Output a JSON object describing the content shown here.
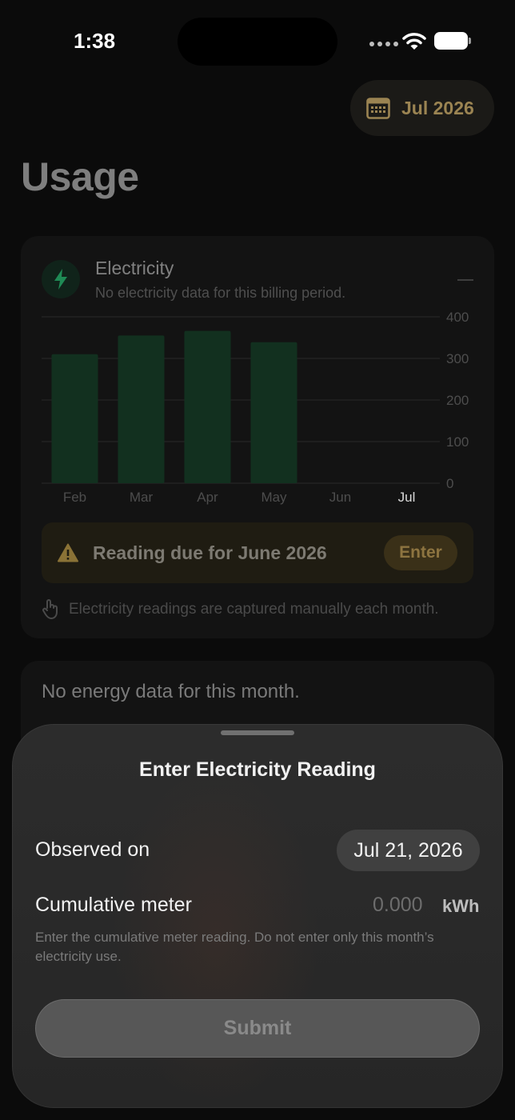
{
  "status_bar": {
    "time": "1:38"
  },
  "header": {
    "month_label": "Jul 2026",
    "month_icon": "calendar-icon",
    "title": "Usage"
  },
  "electricity_card": {
    "title": "Electricity",
    "subtitle": "No electricity data for this billing period.",
    "icon": "bolt-icon",
    "collapse_icon": "minus-icon",
    "due_banner": {
      "icon": "warning-icon",
      "text": "Reading due for June 2026",
      "button": "Enter"
    },
    "hint": {
      "icon": "hand-tap-icon",
      "text": "Electricity readings are captured manually each month."
    }
  },
  "chart_data": {
    "type": "bar",
    "categories": [
      "Feb",
      "Mar",
      "Apr",
      "May",
      "Jun",
      "Jul"
    ],
    "values": [
      310,
      355,
      366,
      339,
      null,
      null
    ],
    "ylim": [
      0,
      400
    ],
    "yticks": [
      0,
      100,
      200,
      300,
      400
    ],
    "highlighted_category": "Jul",
    "grid": true,
    "colors": {
      "bar": "#12301f",
      "grid": "#2a2a2a",
      "tick": "#4d4d4d",
      "highlight": "#d9d9d9"
    }
  },
  "energy_card": {
    "text": "No energy data for this month."
  },
  "sheet": {
    "title": "Enter Electricity Reading",
    "observed_label": "Observed on",
    "observed_date": "Jul 21, 2026",
    "meter_label": "Cumulative meter",
    "meter_placeholder": "0.000",
    "meter_unit": "kWh",
    "help_text": "Enter the cumulative meter reading. Do not enter only this month’s electricity use.",
    "submit": "Submit"
  }
}
